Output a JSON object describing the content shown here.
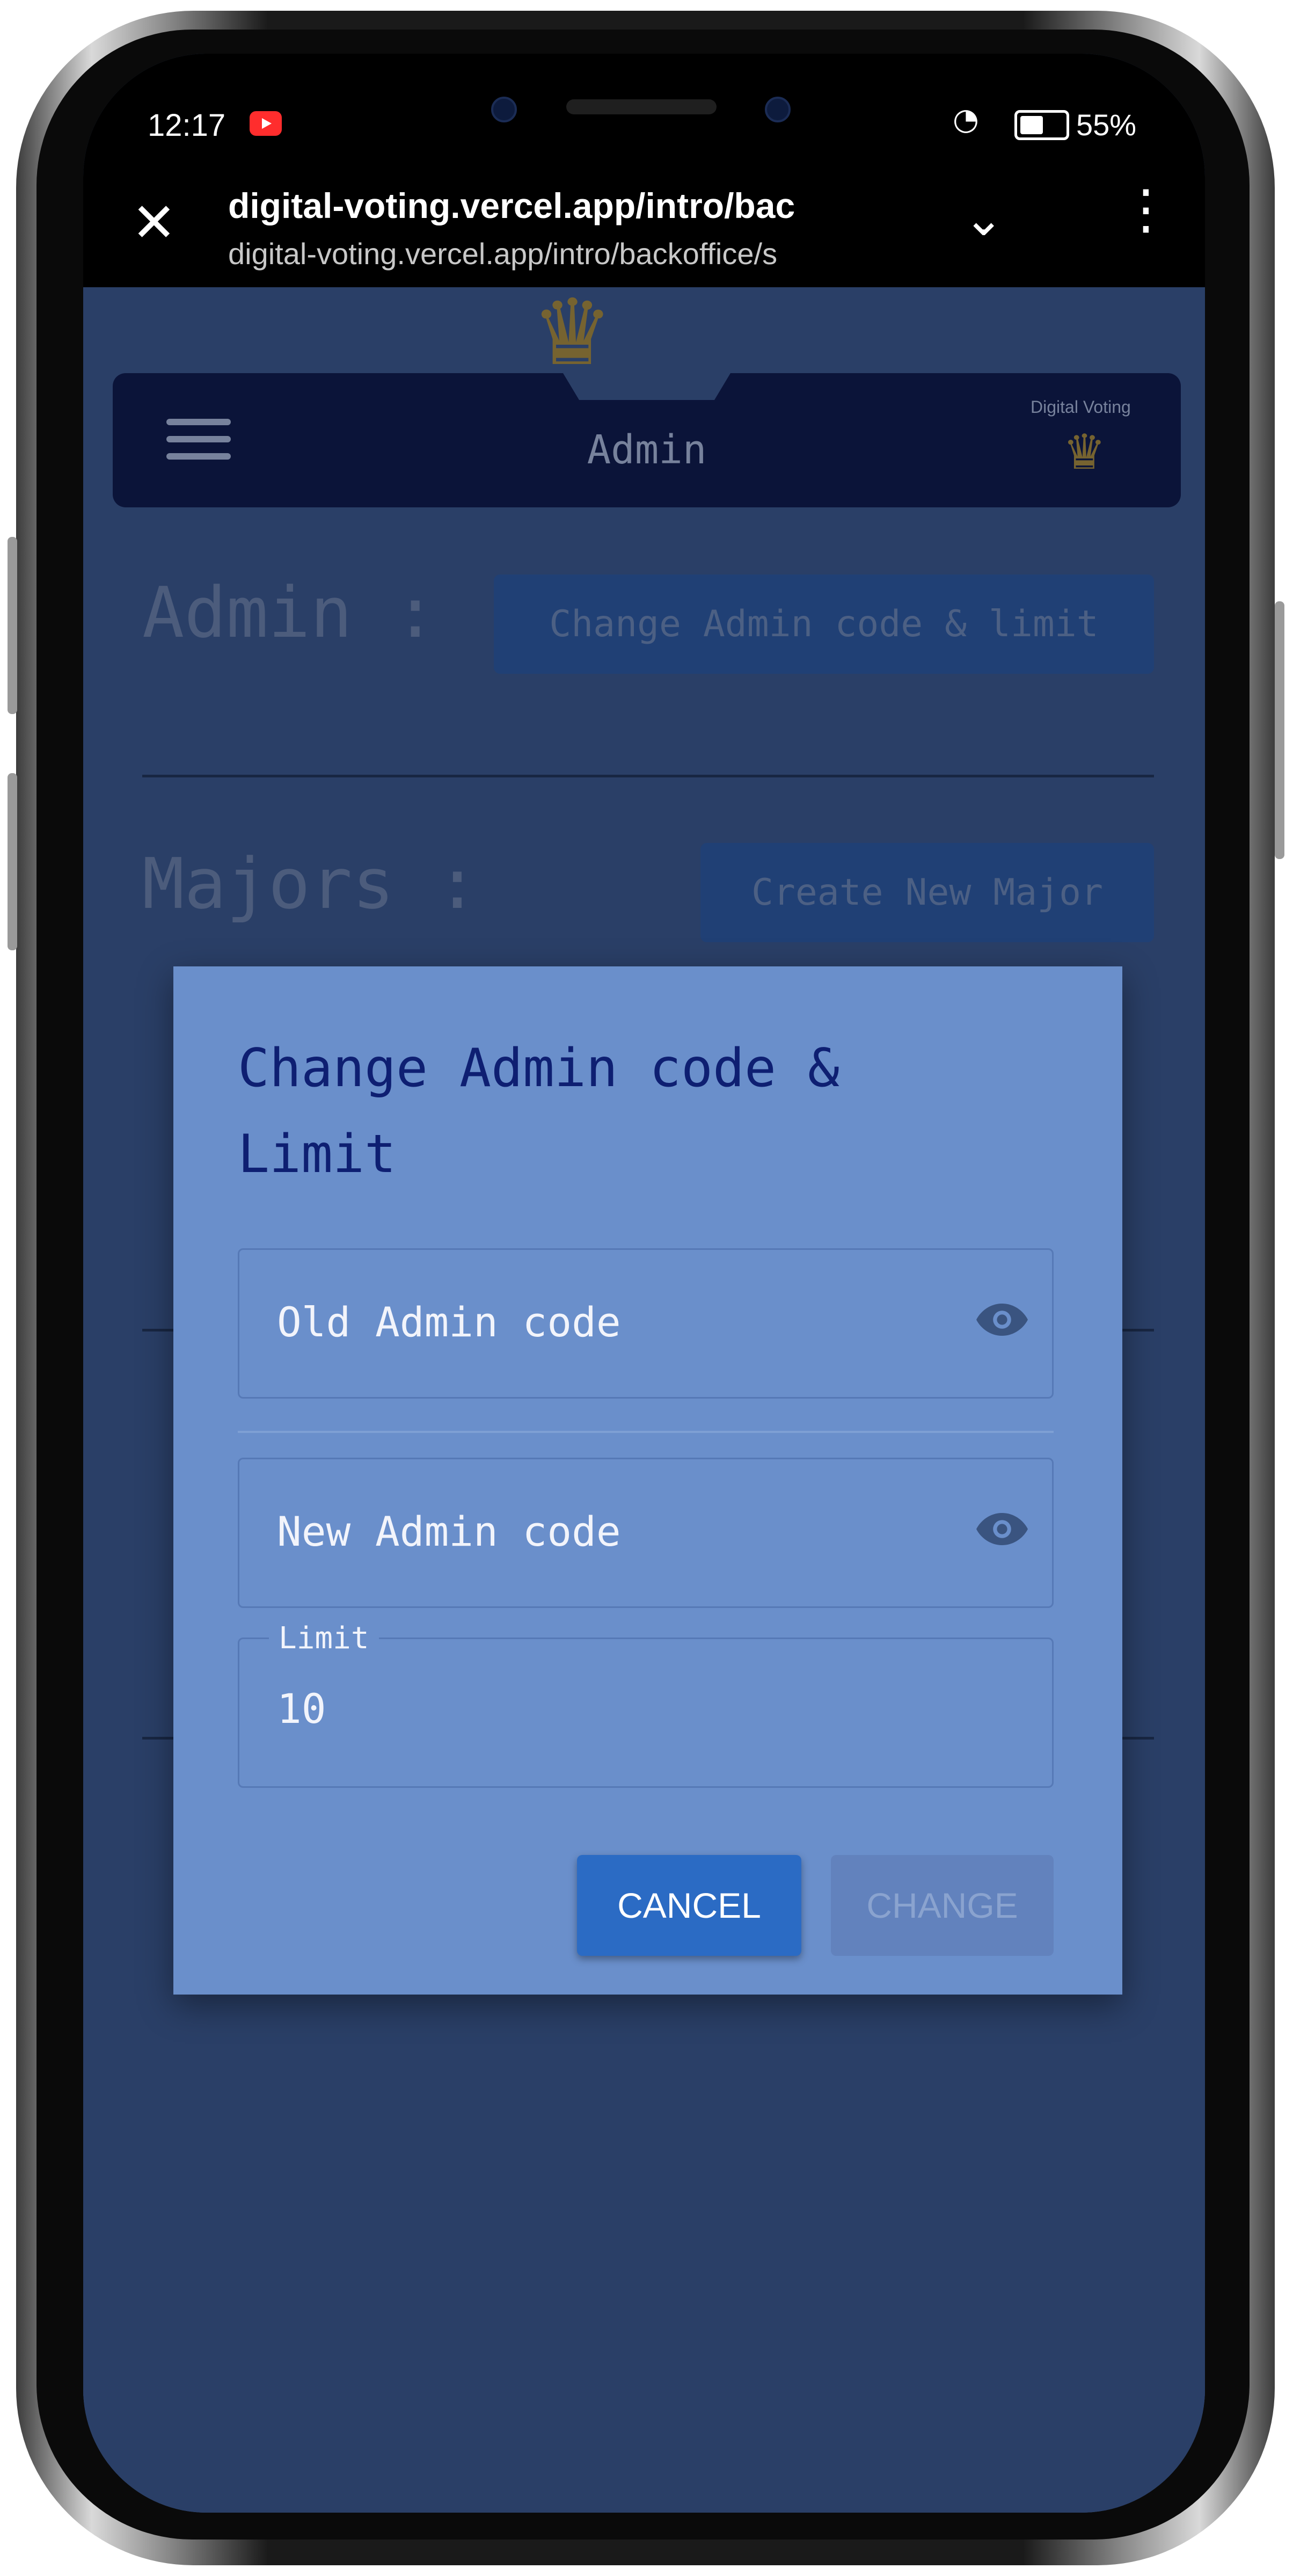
{
  "status_bar": {
    "time": "12:17",
    "battery": "55%",
    "wifi_icon": "wifi-icon"
  },
  "browser": {
    "url_title": "digital-voting.vercel.app/intro/bac",
    "url_full": "digital-voting.vercel.app/intro/backoffice/s"
  },
  "navbar": {
    "title": "Admin",
    "brand": "Digital Voting"
  },
  "page": {
    "admin_label": "Admin :",
    "admin_button": "Change Admin code & limit",
    "majors_label": "Majors :",
    "majors_button": "Create New Major"
  },
  "dialog": {
    "title": "Change Admin code & Limit",
    "old_code_placeholder": "Old Admin code",
    "new_code_placeholder": "New Admin code",
    "limit_label": "Limit",
    "limit_value": "10",
    "cancel_label": "CANCEL",
    "change_label": "CHANGE"
  },
  "colors": {
    "navbar": "#050b3b",
    "dialog": "#6a8fcb",
    "dialog_title": "#0e1f72",
    "accent": "#2b6bc4"
  }
}
